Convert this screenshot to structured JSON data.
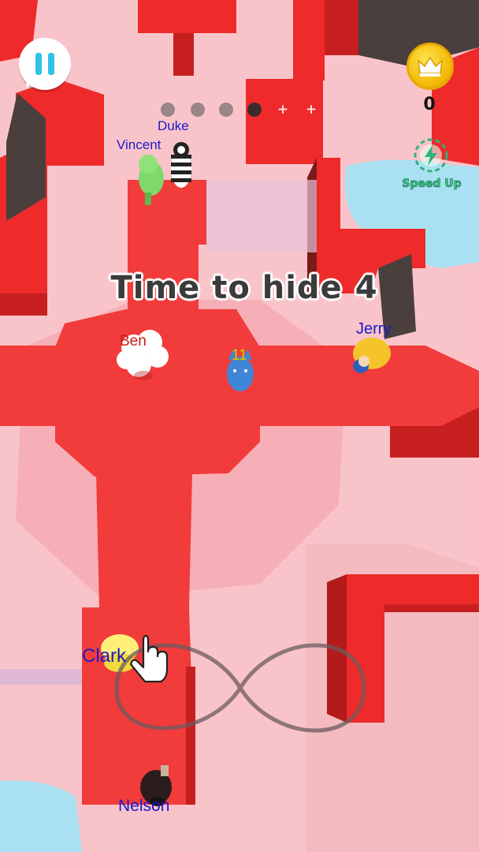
{
  "hud": {
    "pause_icon": "pause-icon",
    "round_indicator": [
      {
        "state": "done",
        "label": ""
      },
      {
        "state": "done",
        "label": ""
      },
      {
        "state": "done",
        "label": ""
      },
      {
        "state": "current",
        "label": ""
      },
      {
        "state": "locked",
        "label": "+"
      },
      {
        "state": "locked",
        "label": "+"
      }
    ],
    "crown_icon": "crown-icon",
    "crown_count": "0",
    "speed_icon": "lightning-icon",
    "speed_label": "Speed Up"
  },
  "countdown": {
    "label": "Time to hide",
    "value": "4"
  },
  "players": [
    {
      "name": "Duke",
      "color": "#1a1acc"
    },
    {
      "name": "Vincent",
      "color": "#1a1acc"
    },
    {
      "name": "Ben",
      "color": "#cc1a1a"
    },
    {
      "name": "Jerry",
      "color": "#1a1acc"
    },
    {
      "name": "Clark",
      "color": "#1a1acc"
    },
    {
      "name": "Nelson",
      "color": "#1a1acc"
    }
  ],
  "seeker_badge": "11",
  "hint": {
    "gesture": "infinity-swipe",
    "icon": "hand-pointer-icon"
  },
  "colors": {
    "floor": "#f9c4c9",
    "wall": "#ee2a2a",
    "wall_dark": "#b31a1a",
    "path": "#f23b3b",
    "water": "#a9e1f3",
    "accent": "#2fc4e8"
  }
}
